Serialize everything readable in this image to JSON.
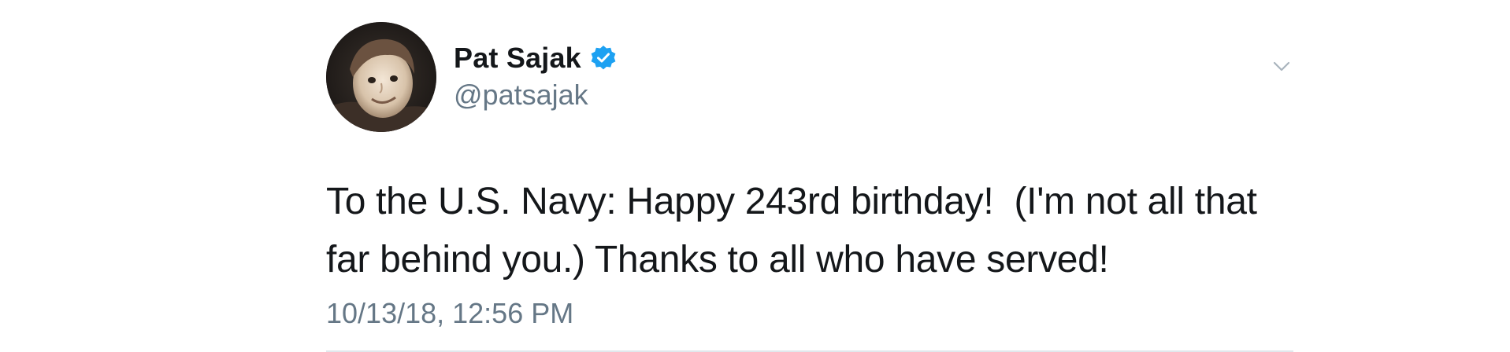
{
  "tweet": {
    "author": {
      "display_name": "Pat Sajak",
      "handle": "@patsajak",
      "verified": true,
      "avatar_icon": "profile-photo"
    },
    "text": "To the U.S. Navy: Happy 243rd birthday!  (I'm not all that\nfar behind you.) Thanks to all who have served!",
    "timestamp": "10/13/18, 12:56 PM",
    "menu_icon": "chevron-down-icon"
  },
  "colors": {
    "verified_blue": "#1da1f2",
    "text_primary": "#14171a",
    "text_secondary": "#657786",
    "divider": "#e1e8ed"
  }
}
